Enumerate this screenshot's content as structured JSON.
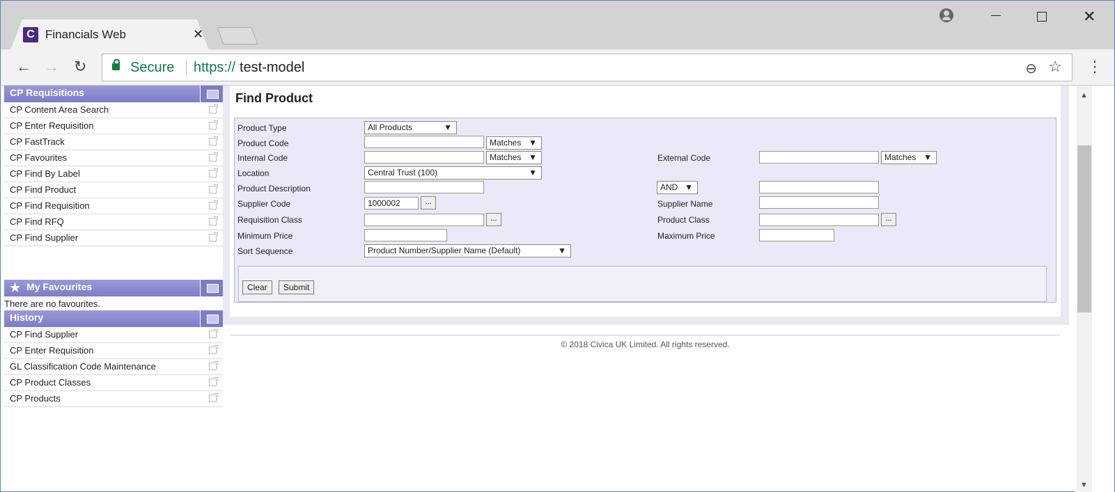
{
  "browser": {
    "tab_title": "Financials Web",
    "favicon_letter": "C",
    "secure_label": "Secure",
    "url_scheme": "https://",
    "url_host": "test-model"
  },
  "sidebar": {
    "requisitions": {
      "title": "CP Requisitions",
      "items": [
        "CP Content Area Search",
        "CP Enter Requisition",
        "CP FastTrack",
        "CP Favourites",
        "CP Find By Label",
        "CP Find Product",
        "CP Find Requisition",
        "CP Find RFQ",
        "CP Find Supplier"
      ]
    },
    "favourites": {
      "title": "My Favourites",
      "empty_text": "There are no favourites."
    },
    "history": {
      "title": "History",
      "items": [
        "CP Find Supplier",
        "CP Enter Requisition",
        "GL Classification Code Maintenance",
        "CP Product Classes",
        "CP Products"
      ]
    }
  },
  "form": {
    "title": "Find Product",
    "product_type": {
      "label": "Product Type",
      "value": "All Products"
    },
    "product_code": {
      "label": "Product Code",
      "value": "",
      "match": "Matches"
    },
    "internal_code": {
      "label": "Internal Code",
      "value": "",
      "match": "Matches"
    },
    "external_code": {
      "label": "External Code",
      "value": "",
      "match": "Matches"
    },
    "location": {
      "label": "Location",
      "value": "Central Trust (100)"
    },
    "product_description": {
      "label": "Product Description",
      "value": "",
      "operator": "AND",
      "value2": ""
    },
    "supplier_code": {
      "label": "Supplier Code",
      "value": "1000002",
      "lookup": "..."
    },
    "supplier_name": {
      "label": "Supplier Name",
      "value": ""
    },
    "requisition_class": {
      "label": "Requisition Class",
      "value": "",
      "lookup": "..."
    },
    "product_class": {
      "label": "Product Class",
      "value": "",
      "lookup": "..."
    },
    "minimum_price": {
      "label": "Minimum Price",
      "value": ""
    },
    "maximum_price": {
      "label": "Maximum Price",
      "value": ""
    },
    "sort_sequence": {
      "label": "Sort Sequence",
      "value": "Product Number/Supplier Name (Default)"
    },
    "buttons": {
      "clear": "Clear",
      "submit": "Submit"
    }
  },
  "footer": {
    "copyright": "© 2018 Civica UK Limited. All rights reserved."
  },
  "icons": {
    "arrow": "▼",
    "back": "←",
    "forward": "→",
    "reload": "↻",
    "close": "✕",
    "star": "☆",
    "zoom": "⊖",
    "menu": "⋮"
  },
  "colors": {
    "panel_header": "#7c7cc9",
    "form_bg": "#e9e9f7",
    "secure_green": "#0b8043",
    "favicon": "#4b2a83"
  }
}
